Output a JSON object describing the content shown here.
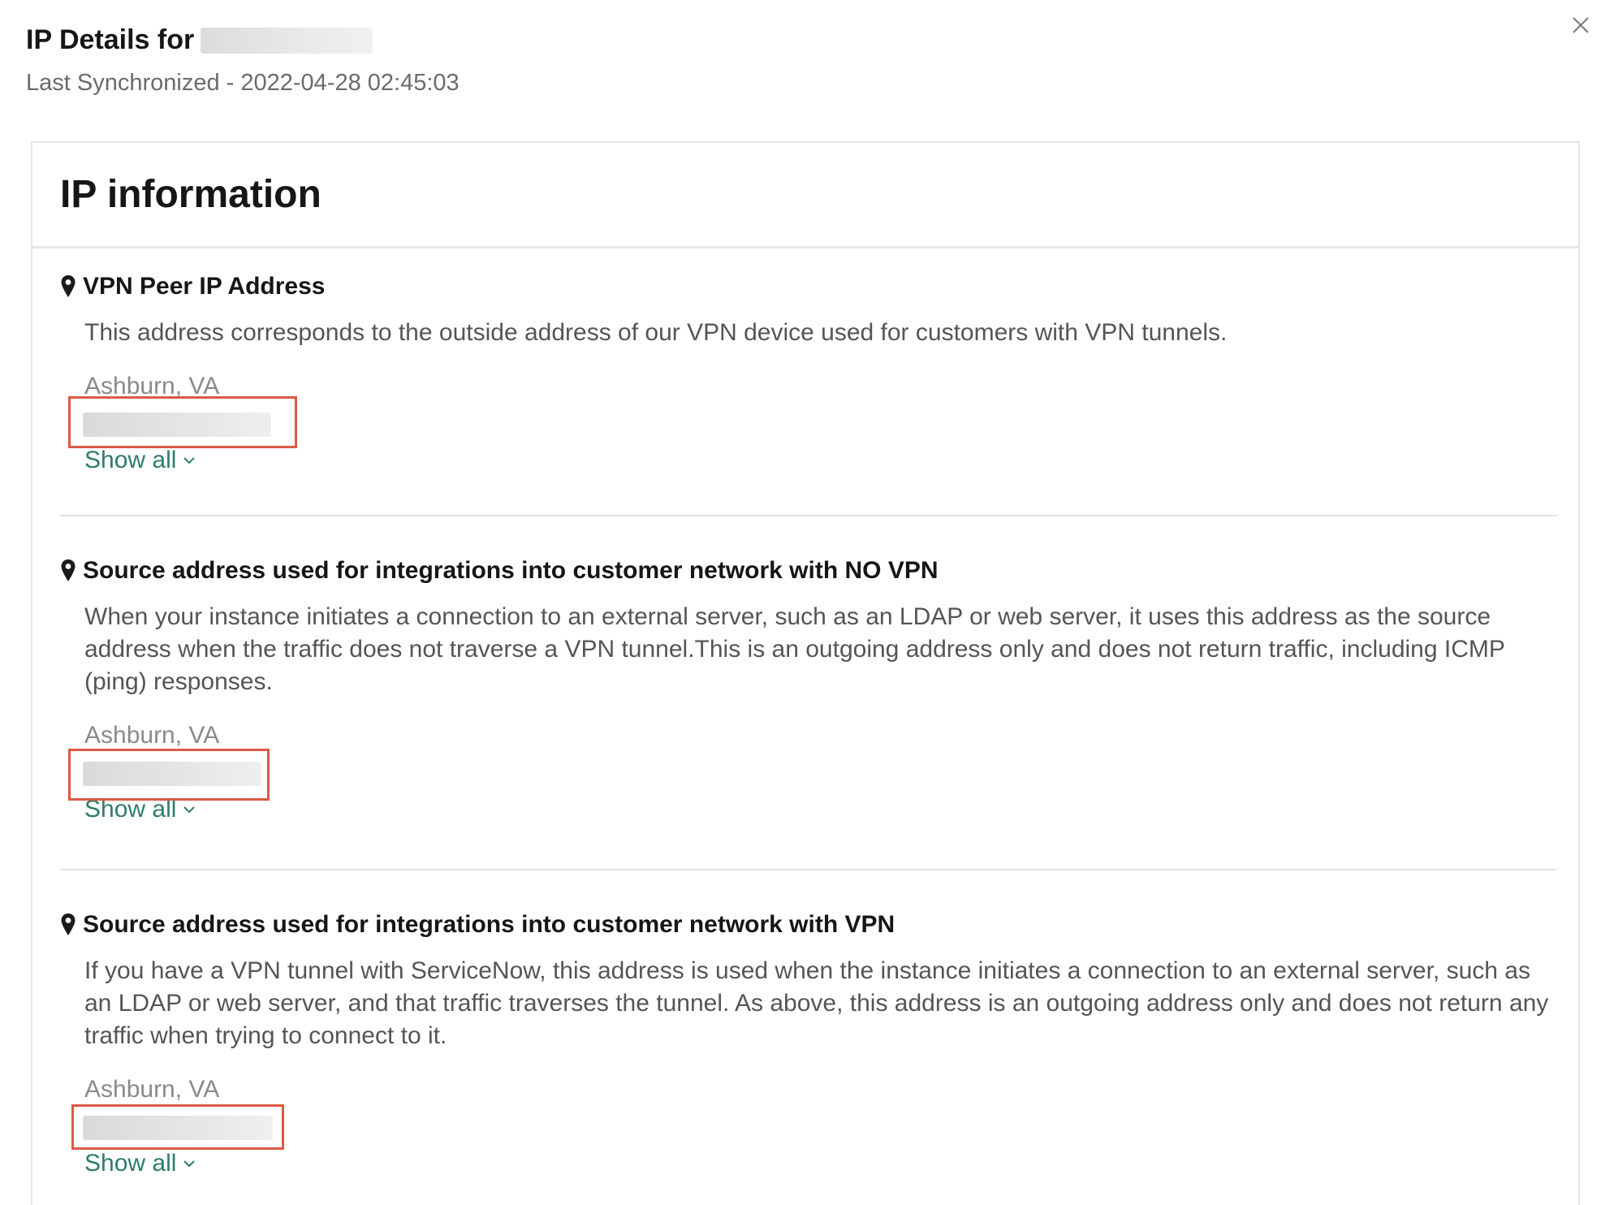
{
  "modal": {
    "title_prefix": "IP Details for",
    "subtitle": "Last Synchronized - 2022-04-28 02:45:03",
    "close_icon": "close-icon"
  },
  "card": {
    "title": "IP information"
  },
  "sections": [
    {
      "title": "VPN Peer IP Address",
      "description": "This address corresponds to the outside address of our VPN device used for customers with VPN tunnels.",
      "location": "Ashburn, VA",
      "show_all": "Show all"
    },
    {
      "title": "Source address used for integrations into customer network with NO VPN",
      "description": "When your instance initiates a connection to an external server, such as an LDAP or web server, it uses this address as the source address when the traffic does not traverse a VPN tunnel.This is an outgoing address only and does not return traffic, including ICMP (ping) responses.",
      "location": "Ashburn, VA",
      "show_all": "Show all"
    },
    {
      "title": "Source address used for integrations into customer network with VPN",
      "description": "If you have a VPN tunnel with ServiceNow, this address is used when the instance initiates a connection to an external server, such as an LDAP or web server, and that traffic traverses the tunnel. As above, this address is an outgoing address only and does not return any traffic when trying to connect to it.",
      "location": "Ashburn, VA",
      "show_all": "Show all"
    }
  ],
  "colors": {
    "highlight": "#dc5a45",
    "link": "#2e7d6a"
  }
}
